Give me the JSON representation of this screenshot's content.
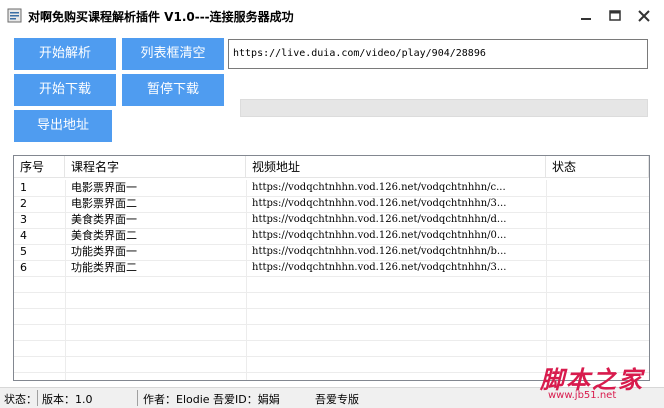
{
  "window": {
    "title": "对啊免购买课程解析插件 V1.0---连接服务器成功"
  },
  "buttons": {
    "start_parse": "开始解析",
    "clear_list": "列表框清空",
    "start_download": "开始下载",
    "pause_download": "暂停下载",
    "export_urls": "导出地址"
  },
  "url_input": {
    "value": "https://live.duia.com/video/play/904/28896"
  },
  "progress": {
    "value_percent": 0
  },
  "table": {
    "columns": [
      "序号",
      "课程名字",
      "视频地址",
      "状态"
    ],
    "rows": [
      {
        "num": "1",
        "name": "电影票界面一",
        "url": "https://vodqchtnhhn.vod.126.net/vodqchtnhhn/c...",
        "status": ""
      },
      {
        "num": "2",
        "name": "电影票界面二",
        "url": "https://vodqchtnhhn.vod.126.net/vodqchtnhhn/3...",
        "status": ""
      },
      {
        "num": "3",
        "name": "美食类界面一",
        "url": "https://vodqchtnhhn.vod.126.net/vodqchtnhhn/d...",
        "status": ""
      },
      {
        "num": "4",
        "name": "美食类界面二",
        "url": "https://vodqchtnhhn.vod.126.net/vodqchtnhhn/0...",
        "status": ""
      },
      {
        "num": "5",
        "name": "功能类界面一",
        "url": "https://vodqchtnhhn.vod.126.net/vodqchtnhhn/b...",
        "status": ""
      },
      {
        "num": "6",
        "name": "功能类界面二",
        "url": "https://vodqchtnhhn.vod.126.net/vodqchtnhhn/3...",
        "status": ""
      }
    ]
  },
  "statusbar": {
    "status_label": "状态：",
    "version": "版本：1.0",
    "author": "作者：Elodie 吾爱ID：娟娟",
    "edition": "吾爱专版"
  },
  "watermark": {
    "main": "脚本之家",
    "sub": "www.jb51.net"
  },
  "colors": {
    "button_bg": "#4f9cf0",
    "button_text": "#ffffff",
    "watermark": "#d81b4d"
  }
}
